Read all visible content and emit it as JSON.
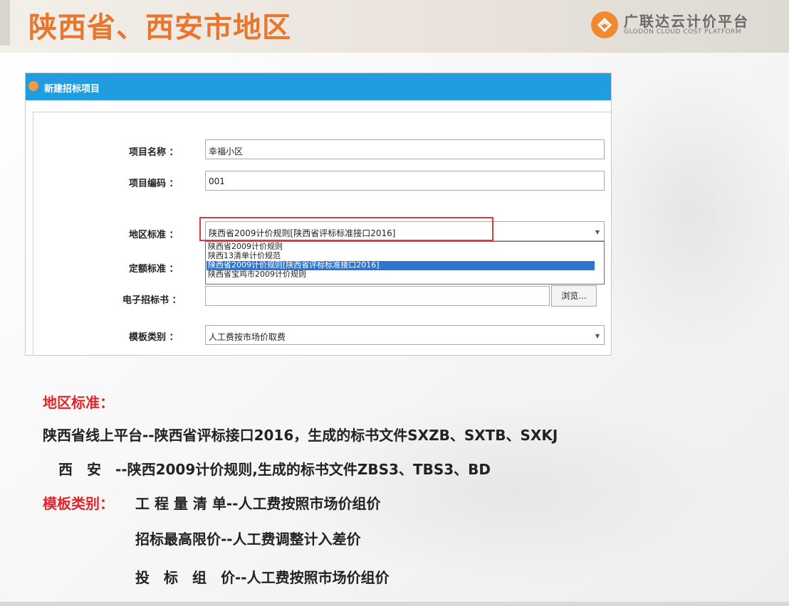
{
  "slide_title": "陕西省、西安市地区",
  "logo": {
    "cn": "广联达云计价平台",
    "en": "GLODON CLOUD COST PLATFORM",
    "icon": "glodon-logo-icon",
    "accent_color": "#ef8a30"
  },
  "dialog": {
    "title": "新建招标项目",
    "titlebar_color": "#1f9de0",
    "fields": {
      "project_name": {
        "label": "项目名称 ：",
        "value": "幸福小区"
      },
      "project_code": {
        "label": "项目编码 ：",
        "value": "001"
      },
      "region_standard": {
        "label": "地区标准 ：",
        "value": "陕西省2009计价规则[陕西省评标标准接口2016]",
        "options": [
          "陕西省2009计价规则",
          "陕西13清单计价规范",
          "陕西省2009计价规则[陕西省评标标准接口2016]",
          "陕西省宝鸡市2009计价规则"
        ],
        "selected_index": 2
      },
      "quota_standard": {
        "label": "定额标准 ："
      },
      "e_tender_book": {
        "label": "电子招标书 ：",
        "value": "",
        "browse_label": "浏览..."
      },
      "template_type": {
        "label": "模板类别 ：",
        "value": "人工费按市场价取费"
      }
    }
  },
  "notes": {
    "region_heading": "地区标准：",
    "line1": "陕西省线上平台--陕西省评标接口2016，生成的标书文件SXZB、SXTB、SXKJ",
    "line2": "西　安　--陕西2009计价规则,生成的标书文件ZBS3、TBS3、BD",
    "template_heading": "模板类别：",
    "line3": "工 程 量 清 单--人工费按照市场价组价",
    "line4": "招标最高限价--人工费调整计入差价",
    "line5": "投　标　组　价--人工费按照市场价组价"
  }
}
